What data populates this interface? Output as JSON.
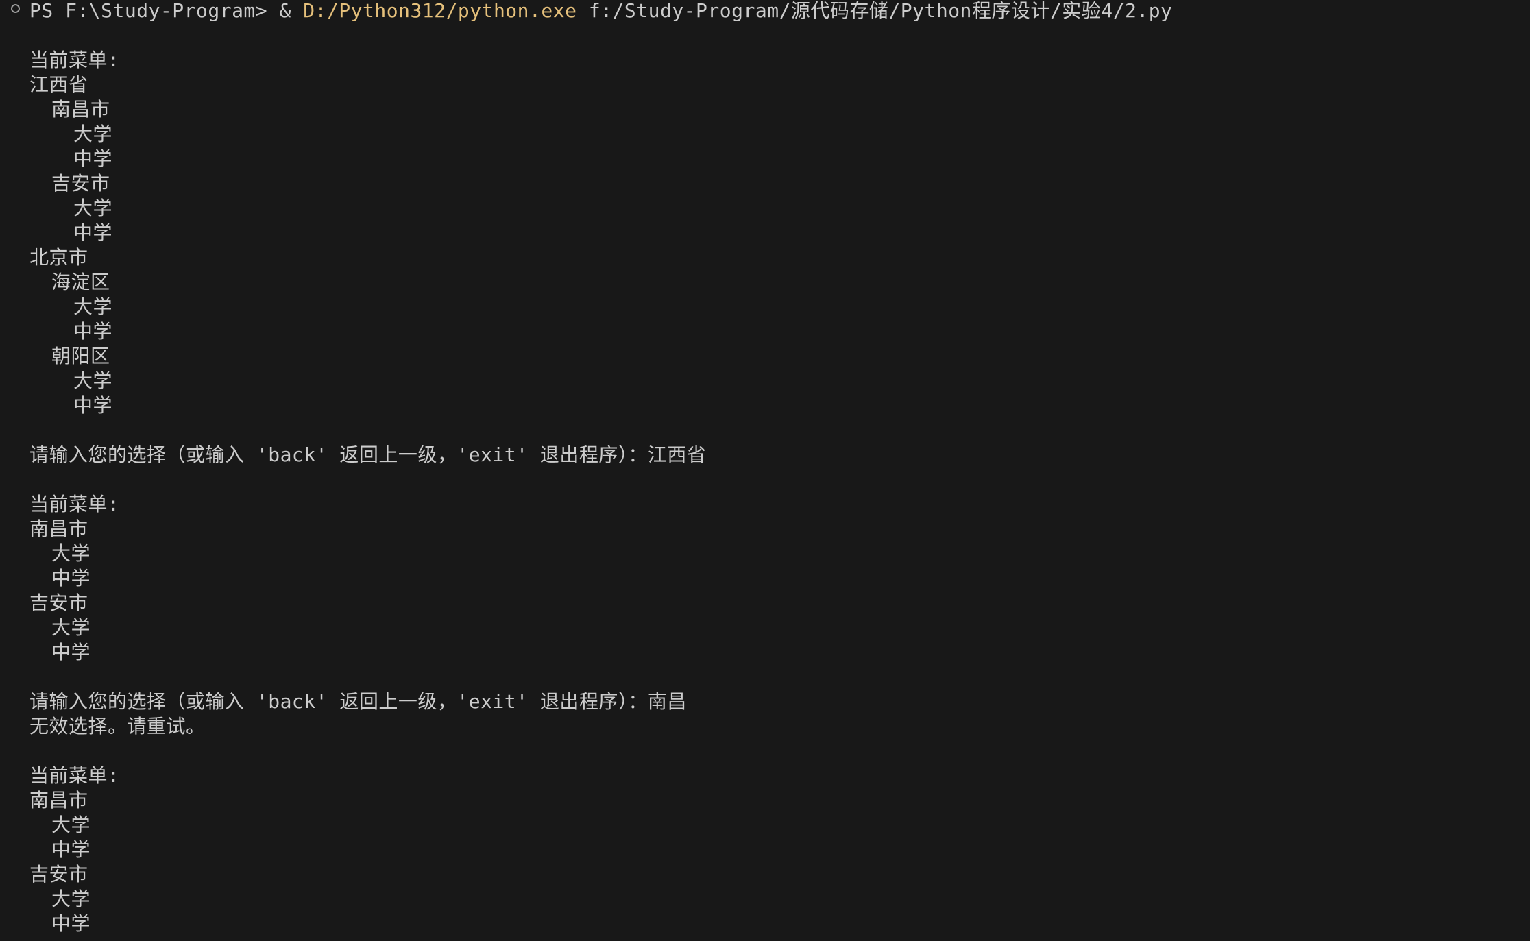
{
  "colors": {
    "background": "#181818",
    "text": "#cccccc",
    "command_highlight": "#e5c07b"
  },
  "command": {
    "prompt": "PS F:\\Study-Program> ",
    "operator": "& ",
    "executable": "D:/Python312/python.exe",
    "script": " f:/Study-Program/源代码存储/Python程序设计/实验4/2.py"
  },
  "output": {
    "menu1_title": "当前菜单:",
    "m1_jiangxi": "江西省",
    "m1_nanchang": "南昌市",
    "m1_nc_daxue": "大学",
    "m1_nc_zhongxue": "中学",
    "m1_jian": "吉安市",
    "m1_ja_daxue": "大学",
    "m1_ja_zhongxue": "中学",
    "m1_beijing": "北京市",
    "m1_haidian": "海淀区",
    "m1_hd_daxue": "大学",
    "m1_hd_zhongxue": "中学",
    "m1_chaoyang": "朝阳区",
    "m1_cy_daxue": "大学",
    "m1_cy_zhongxue": "中学",
    "prompt1_text": "请输入您的选择（或输入 'back' 返回上一级，'exit' 退出程序）：",
    "prompt1_input": "江西省",
    "menu2_title": "当前菜单:",
    "m2_nanchang": "南昌市",
    "m2_nc_daxue": "大学",
    "m2_nc_zhongxue": "中学",
    "m2_jian": "吉安市",
    "m2_ja_daxue": "大学",
    "m2_ja_zhongxue": "中学",
    "prompt2_text": "请输入您的选择（或输入 'back' 返回上一级，'exit' 退出程序）：",
    "prompt2_input": "南昌",
    "invalid_msg": "无效选择。请重试。",
    "menu3_title": "当前菜单:",
    "m3_nanchang": "南昌市",
    "m3_nc_daxue": "大学",
    "m3_nc_zhongxue": "中学",
    "m3_jian": "吉安市",
    "m3_ja_daxue": "大学",
    "m3_ja_zhongxue": "中学"
  }
}
